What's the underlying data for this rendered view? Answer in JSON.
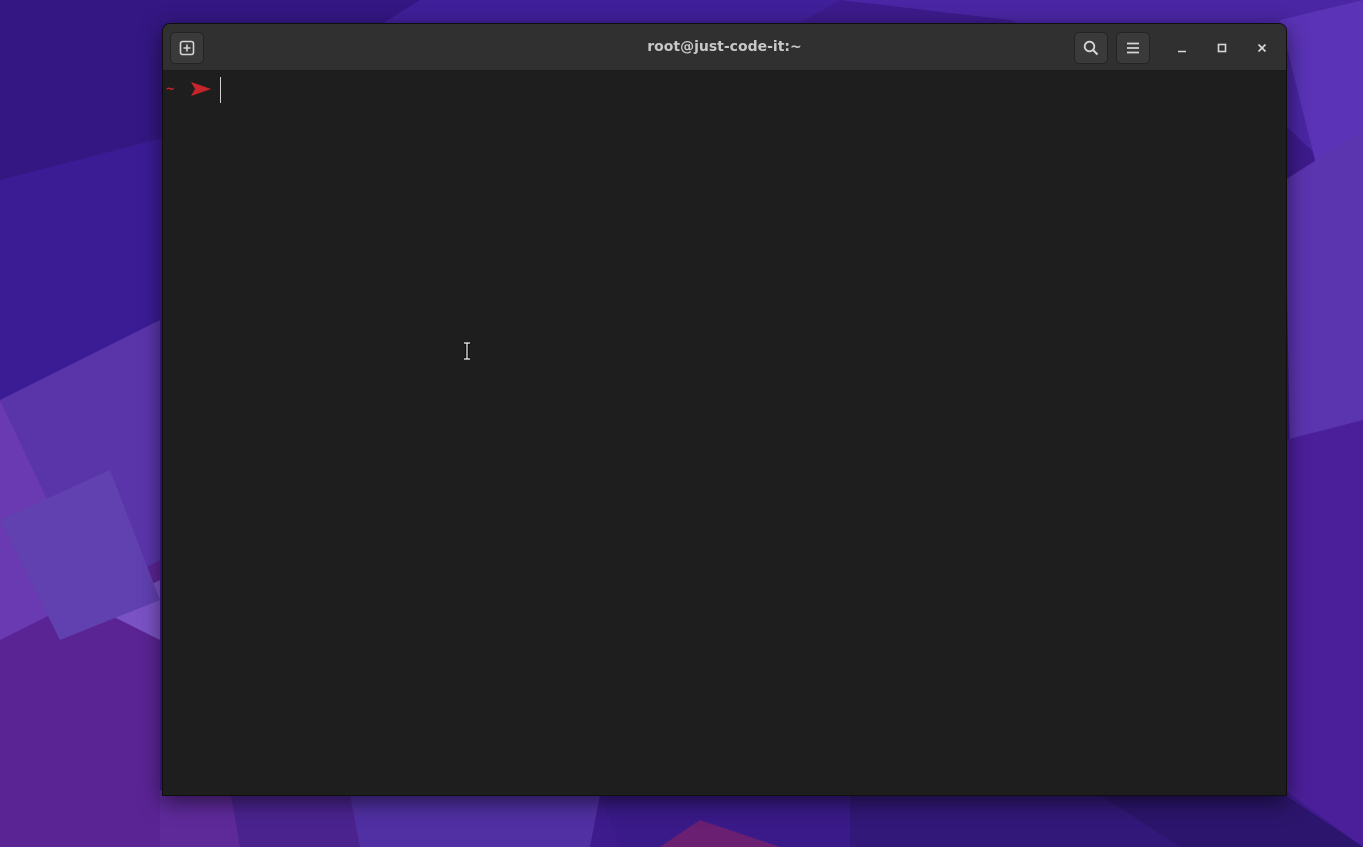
{
  "window": {
    "title": "root@just-code-it:~"
  },
  "headerbar": {
    "left_icons": [
      "new-tab-icon"
    ],
    "right_icons": [
      "search-icon",
      "hamburger-menu-icon",
      "minimize-icon",
      "maximize-icon",
      "close-icon"
    ]
  },
  "terminal": {
    "prompt_dir": "~",
    "prompt_symbol_icon": "arrow-right-icon",
    "input_text": ""
  },
  "colors": {
    "prompt_accent": "#c8242b",
    "terminal_bg": "#1e1e1e",
    "headerbar_bg": "#303030",
    "title_text": "#c8c8c8"
  }
}
